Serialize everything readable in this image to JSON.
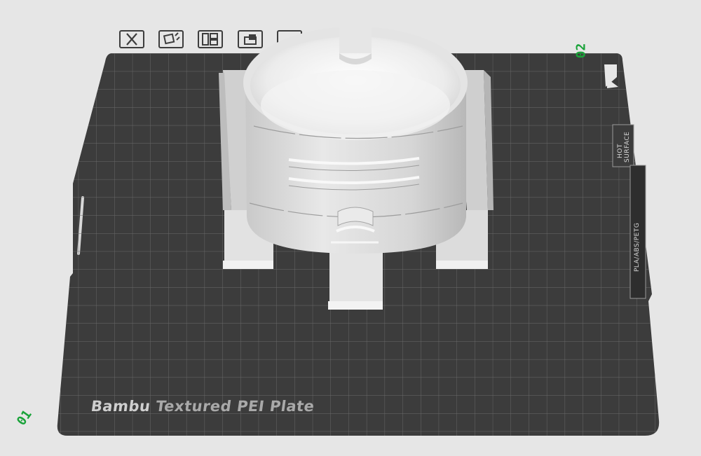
{
  "viewport": {
    "plate_name_brand": "Bambu",
    "plate_name_rest": "Textured PEI Plate",
    "plate_number_left": "01",
    "plate_number_right": "02",
    "side_label_filament": "PLA/ABS/PETG",
    "side_label_hot": "HOT",
    "side_label_surface": "SURFACE"
  },
  "toolbar": {
    "icons": [
      "delete-icon",
      "arrange-icon",
      "layout-icon",
      "lock-icon",
      "settings-icon"
    ]
  },
  "colors": {
    "background": "#e6e6e6",
    "plate": "#3c3c3c",
    "grid": "#6a6a6a",
    "model": "#dcdcdc",
    "plate_number": "#1aa33a"
  }
}
